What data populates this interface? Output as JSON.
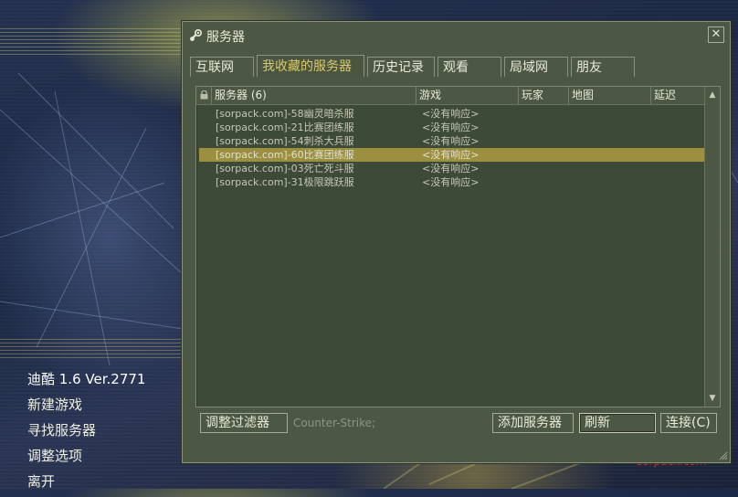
{
  "background": {
    "menu": {
      "version": "迪酷 1.6 Ver.2771",
      "items": [
        "新建游戏",
        "寻找服务器",
        "调整选项",
        "离开"
      ]
    },
    "watermark": "sorpack.com"
  },
  "window": {
    "title": "服务器",
    "close_symbol": "✕",
    "tabs": [
      {
        "label": "互联网",
        "active": false
      },
      {
        "label": "我收藏的服务器",
        "active": true
      },
      {
        "label": "历史记录",
        "active": false
      },
      {
        "label": "观看",
        "active": false
      },
      {
        "label": "局域网",
        "active": false
      },
      {
        "label": "朋友",
        "active": false
      }
    ],
    "table": {
      "columns": [
        "服务器 (6)",
        "游戏",
        "玩家",
        "地图",
        "延迟"
      ],
      "rows": [
        {
          "name": "[sorpack.com]-58幽灵暗杀服",
          "game": "<没有响应>",
          "selected": false
        },
        {
          "name": "[sorpack.com]-21比赛团练服",
          "game": "<没有响应>",
          "selected": false
        },
        {
          "name": "[sorpack.com]-54刺杀大兵服",
          "game": "<没有响应>",
          "selected": false
        },
        {
          "name": "[sorpack.com]-60比赛团练服",
          "game": "<没有响应>",
          "selected": true
        },
        {
          "name": "[sorpack.com]-03死亡死斗服",
          "game": "<没有响应>",
          "selected": false
        },
        {
          "name": "[sorpack.com]-31极限跳跃服",
          "game": "<没有响应>",
          "selected": false
        }
      ]
    },
    "buttons": {
      "filter": "调整过滤器",
      "filter_status": "Counter-Strike;",
      "add_server": "添加服务器",
      "refresh": "刷新",
      "connect": "连接(C)"
    },
    "colors": {
      "window_bg": "#4c5844",
      "selected_row": "#9c9040",
      "active_tab_text": "#d8c86a"
    }
  }
}
